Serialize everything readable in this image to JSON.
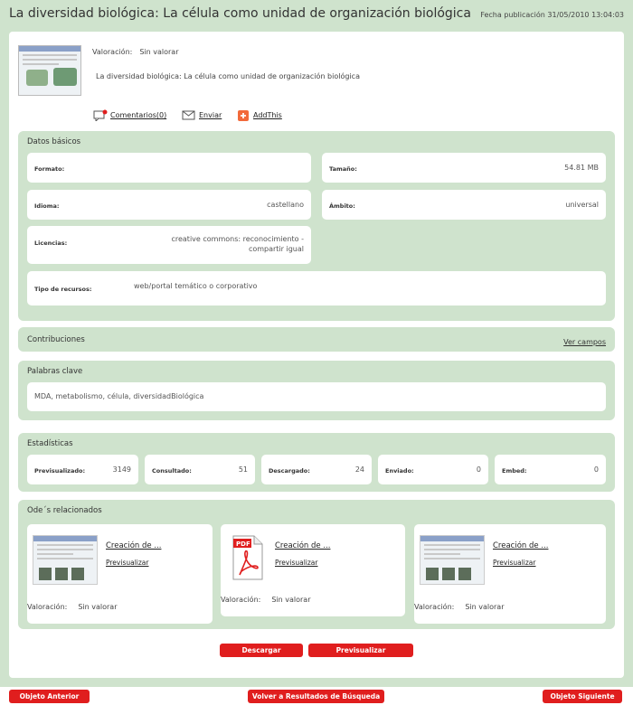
{
  "header": {
    "title": "La diversidad biológica: La célula como unidad de organización biológica",
    "pubdate": "Fecha publicación 31/05/2010 13:04:03"
  },
  "summary": {
    "rating_label": "Valoración:",
    "rating_value": "Sin valorar",
    "description": "La diversidad biológica: La célula como unidad de organización biológica"
  },
  "actions": {
    "comments": "Comentarios(0)",
    "send": "Enviar",
    "addthis": "AddThis"
  },
  "datos_basicos": {
    "title": "Datos básicos",
    "formato_label": "Formato:",
    "formato_value": "",
    "tamano_label": "Tamaño:",
    "tamano_value": "54.81 MB",
    "idioma_label": "Idioma:",
    "idioma_value": "castellano",
    "ambito_label": "Ámbito:",
    "ambito_value": "universal",
    "licencias_label": "Licencias:",
    "licencias_value": "creative commons: reconocimiento - compartir igual",
    "tipo_label": "Tipo de recursos:",
    "tipo_value": "web/portal temático o corporativo"
  },
  "contribuciones": {
    "title": "Contribuciones",
    "link": "Ver campos"
  },
  "palabras_clave": {
    "title": "Palabras clave",
    "value": "MDA, metabolismo, célula, diversidadBiológica"
  },
  "estadisticas": {
    "title": "Estadísticas",
    "items": [
      {
        "label": "Previsualizado:",
        "value": "3149"
      },
      {
        "label": "Consultado:",
        "value": "51"
      },
      {
        "label": "Descargado:",
        "value": "24"
      },
      {
        "label": "Enviado:",
        "value": "0"
      },
      {
        "label": "Embed:",
        "value": "0"
      }
    ]
  },
  "relacionados": {
    "title": "Ode´s relacionados",
    "items": [
      {
        "title": "Creación de ...",
        "preview": "Previsualizar",
        "rating_label": "Valoración:",
        "rating_value": "Sin valorar"
      },
      {
        "title": "Creación de ...",
        "preview": "Previsualizar",
        "rating_label": "Valoración:",
        "rating_value": "Sin valorar"
      },
      {
        "title": "Creación de ...",
        "preview": "Previsualizar",
        "rating_label": "Valoración:",
        "rating_value": "Sin valorar"
      }
    ]
  },
  "buttons": {
    "download": "Descargar",
    "preview": "Previsualizar",
    "prev": "Objeto Anterior",
    "back": "Volver a Resultados de Búsqueda",
    "next": "Objeto Siguiente"
  },
  "colors": {
    "accent_red": "#e01e1e",
    "section_green": "#cfe3cd"
  }
}
